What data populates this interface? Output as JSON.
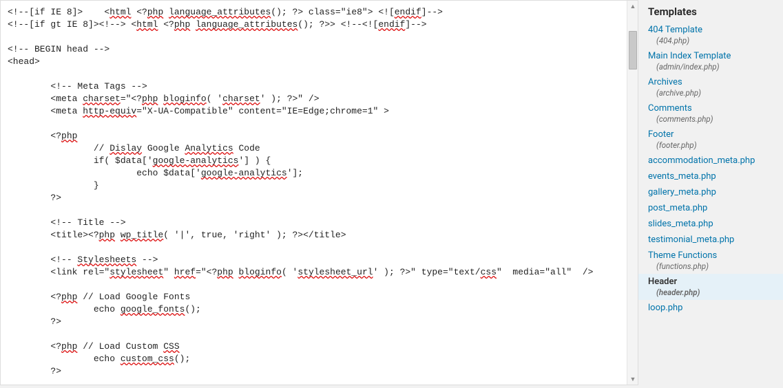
{
  "editor": {
    "lines": [
      {
        "indent": 0,
        "segments": [
          {
            "t": "<!--[if IE 8]>    <"
          },
          {
            "t": "html",
            "s": 1
          },
          {
            "t": " <?"
          },
          {
            "t": "php",
            "s": 1
          },
          {
            "t": " "
          },
          {
            "t": "language_attributes",
            "s": 1
          },
          {
            "t": "(); ?> class=\"ie8\"> <!["
          },
          {
            "t": "endif",
            "s": 1
          },
          {
            "t": "]-->"
          }
        ]
      },
      {
        "indent": 0,
        "segments": [
          {
            "t": "<!--[if gt IE 8]><!--> <"
          },
          {
            "t": "html",
            "s": 1
          },
          {
            "t": " <?"
          },
          {
            "t": "php",
            "s": 1
          },
          {
            "t": " "
          },
          {
            "t": "language_attributes",
            "s": 1
          },
          {
            "t": "(); ?>> <!--<!["
          },
          {
            "t": "endif",
            "s": 1
          },
          {
            "t": "]-->"
          }
        ]
      },
      {
        "indent": 0,
        "segments": []
      },
      {
        "indent": 0,
        "segments": [
          {
            "t": "<!-- BEGIN head -->"
          }
        ]
      },
      {
        "indent": 0,
        "segments": [
          {
            "t": "<head>"
          }
        ]
      },
      {
        "indent": 0,
        "segments": []
      },
      {
        "indent": 2,
        "segments": [
          {
            "t": "<!-- Meta Tags -->"
          }
        ]
      },
      {
        "indent": 2,
        "segments": [
          {
            "t": "<meta "
          },
          {
            "t": "charset",
            "s": 1
          },
          {
            "t": "=\"<?"
          },
          {
            "t": "php",
            "s": 1
          },
          {
            "t": " "
          },
          {
            "t": "bloginfo",
            "s": 1
          },
          {
            "t": "( '"
          },
          {
            "t": "charset",
            "s": 1
          },
          {
            "t": "' ); ?>\" />"
          }
        ]
      },
      {
        "indent": 2,
        "segments": [
          {
            "t": "<meta "
          },
          {
            "t": "http-equiv",
            "s": 1
          },
          {
            "t": "=\"X-UA-Compatible\" content=\"IE=Edge;chrome=1\" >"
          }
        ]
      },
      {
        "indent": 0,
        "segments": []
      },
      {
        "indent": 2,
        "segments": [
          {
            "t": "<?"
          },
          {
            "t": "php",
            "s": 1
          }
        ]
      },
      {
        "indent": 4,
        "segments": [
          {
            "t": "// "
          },
          {
            "t": "Dislay",
            "s": 1
          },
          {
            "t": " Google "
          },
          {
            "t": "Analytics",
            "s": 1
          },
          {
            "t": " Code"
          }
        ]
      },
      {
        "indent": 4,
        "segments": [
          {
            "t": "if( $data['"
          },
          {
            "t": "google-analytics",
            "s": 1
          },
          {
            "t": "'] ) {"
          }
        ]
      },
      {
        "indent": 6,
        "segments": [
          {
            "t": "echo $data['"
          },
          {
            "t": "google-analytics",
            "s": 1
          },
          {
            "t": "'];"
          }
        ]
      },
      {
        "indent": 4,
        "segments": [
          {
            "t": "}"
          }
        ]
      },
      {
        "indent": 2,
        "segments": [
          {
            "t": "?>"
          }
        ]
      },
      {
        "indent": 0,
        "segments": []
      },
      {
        "indent": 2,
        "segments": [
          {
            "t": "<!-- Title -->"
          }
        ]
      },
      {
        "indent": 2,
        "segments": [
          {
            "t": "<title><?"
          },
          {
            "t": "php",
            "s": 1
          },
          {
            "t": " "
          },
          {
            "t": "wp_title",
            "s": 1
          },
          {
            "t": "( '|', true, 'right' ); ?></title>"
          }
        ]
      },
      {
        "indent": 0,
        "segments": []
      },
      {
        "indent": 2,
        "segments": [
          {
            "t": "<!-- "
          },
          {
            "t": "Stylesheets",
            "s": 1
          },
          {
            "t": " -->"
          }
        ]
      },
      {
        "indent": 2,
        "segments": [
          {
            "t": "<link rel=\""
          },
          {
            "t": "stylesheet",
            "s": 1
          },
          {
            "t": "\" "
          },
          {
            "t": "href",
            "s": 1
          },
          {
            "t": "=\"<?"
          },
          {
            "t": "php",
            "s": 1
          },
          {
            "t": " "
          },
          {
            "t": "bloginfo",
            "s": 1
          },
          {
            "t": "( '"
          },
          {
            "t": "stylesheet_url",
            "s": 1
          },
          {
            "t": "' ); ?>\" type=\"text/"
          },
          {
            "t": "css",
            "s": 1
          },
          {
            "t": "\"  media=\"all\"  />"
          }
        ]
      },
      {
        "indent": 0,
        "segments": []
      },
      {
        "indent": 2,
        "segments": [
          {
            "t": "<?"
          },
          {
            "t": "php",
            "s": 1
          },
          {
            "t": " // Load Google Fonts"
          }
        ]
      },
      {
        "indent": 4,
        "segments": [
          {
            "t": "echo "
          },
          {
            "t": "google_fonts",
            "s": 1
          },
          {
            "t": "();"
          }
        ]
      },
      {
        "indent": 2,
        "segments": [
          {
            "t": "?>"
          }
        ]
      },
      {
        "indent": 0,
        "segments": []
      },
      {
        "indent": 2,
        "segments": [
          {
            "t": "<?"
          },
          {
            "t": "php",
            "s": 1
          },
          {
            "t": " // Load Custom "
          },
          {
            "t": "CSS",
            "s": 1
          }
        ]
      },
      {
        "indent": 4,
        "segments": [
          {
            "t": "echo "
          },
          {
            "t": "custom_css",
            "s": 1
          },
          {
            "t": "();"
          }
        ]
      },
      {
        "indent": 2,
        "segments": [
          {
            "t": "?>"
          }
        ]
      }
    ]
  },
  "sidebar": {
    "title": "Templates",
    "items": [
      {
        "label": "404 Template",
        "file": "(404.php)",
        "current": false
      },
      {
        "label": "Main Index Template",
        "file": "(admin/index.php)",
        "current": false
      },
      {
        "label": "Archives",
        "file": "(archive.php)",
        "current": false
      },
      {
        "label": "Comments",
        "file": "(comments.php)",
        "current": false
      },
      {
        "label": "Footer",
        "file": "(footer.php)",
        "current": false
      },
      {
        "label": "accommodation_meta.php",
        "file": "",
        "current": false
      },
      {
        "label": "events_meta.php",
        "file": "",
        "current": false
      },
      {
        "label": "gallery_meta.php",
        "file": "",
        "current": false
      },
      {
        "label": "post_meta.php",
        "file": "",
        "current": false
      },
      {
        "label": "slides_meta.php",
        "file": "",
        "current": false
      },
      {
        "label": "testimonial_meta.php",
        "file": "",
        "current": false
      },
      {
        "label": "Theme Functions",
        "file": "(functions.php)",
        "current": false
      },
      {
        "label": "Header",
        "file": "(header.php)",
        "current": true
      },
      {
        "label": "loop.php",
        "file": "",
        "current": false
      }
    ]
  }
}
